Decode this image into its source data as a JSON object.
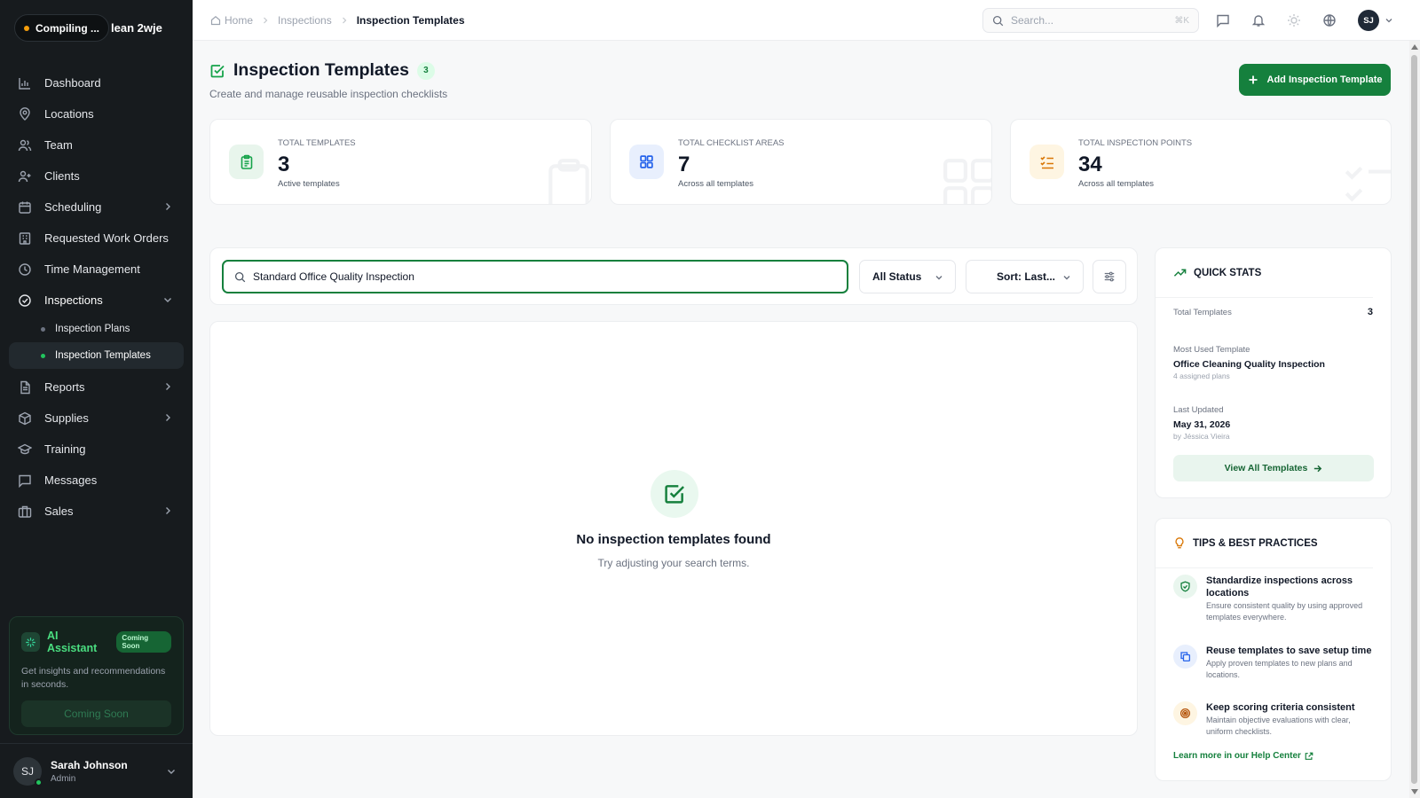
{
  "brand": {
    "status": "Compiling ...",
    "name": "lean 2wje"
  },
  "nav": {
    "items": [
      {
        "label": "Dashboard"
      },
      {
        "label": "Locations"
      },
      {
        "label": "Team"
      },
      {
        "label": "Clients"
      },
      {
        "label": "Scheduling"
      },
      {
        "label": "Requested Work Orders"
      },
      {
        "label": "Time Management"
      },
      {
        "label": "Inspections"
      },
      {
        "label": "Reports"
      },
      {
        "label": "Supplies"
      },
      {
        "label": "Training"
      },
      {
        "label": "Messages"
      },
      {
        "label": "Sales"
      }
    ],
    "sub_items": [
      {
        "label": "Inspection Plans"
      },
      {
        "label": "Inspection Templates"
      }
    ]
  },
  "ai_assistant": {
    "title": "AI Assistant",
    "badge": "Coming Soon",
    "description": "Get insights and recommendations in seconds.",
    "button": "Coming Soon"
  },
  "user": {
    "initials": "SJ",
    "name": "Sarah Johnson",
    "role": "Admin"
  },
  "breadcrumb": [
    "Home",
    "Inspections",
    "Inspection Templates"
  ],
  "topbar": {
    "search_placeholder": "Search...",
    "shortcut": "⌘K",
    "avatar_initials": "SJ"
  },
  "page": {
    "title": "Inspection Templates",
    "count": "3",
    "subtitle": "Create and manage reusable inspection checklists",
    "add_button": "Add Inspection Template"
  },
  "stats": [
    {
      "label": "TOTAL TEMPLATES",
      "value": "3",
      "desc": "Active templates",
      "color": "#16a34a"
    },
    {
      "label": "TOTAL CHECKLIST AREAS",
      "value": "7",
      "desc": "Across all templates",
      "color": "#2563eb"
    },
    {
      "label": "TOTAL INSPECTION POINTS",
      "value": "34",
      "desc": "Across all templates",
      "color": "#d97706"
    }
  ],
  "filters": {
    "search_value": "Standard Office Quality Inspection",
    "status": "All Status",
    "sort": "Sort: Last..."
  },
  "empty_state": {
    "title": "No inspection templates found",
    "subtitle": "Try adjusting your search terms."
  },
  "quick_stats": {
    "title": "QUICK STATS",
    "total_label": "Total Templates",
    "total_value": "3",
    "most_used_label": "Most Used Template",
    "most_used_value": "Office Cleaning Quality Inspection",
    "most_used_sub": "4 assigned plans",
    "last_updated_label": "Last Updated",
    "last_updated_value": "May 31, 2026",
    "last_updated_by": "by Jéssica Vieira",
    "button": "View All Templates"
  },
  "tips": {
    "title": "TIPS & BEST PRACTICES",
    "items": [
      {
        "title": "Standardize inspections across locations",
        "desc": "Ensure consistent quality by using approved templates everywhere."
      },
      {
        "title": "Reuse templates to save setup time",
        "desc": "Apply proven templates to new plans and locations."
      },
      {
        "title": "Keep scoring criteria consistent",
        "desc": "Maintain objective evaluations with clear, uniform checklists."
      }
    ],
    "help_link": "Learn more in our Help Center"
  },
  "colors": {
    "accent": "#15803d",
    "sidebar_bg": "#171b1e",
    "page_bg": "#f7f8f9"
  }
}
